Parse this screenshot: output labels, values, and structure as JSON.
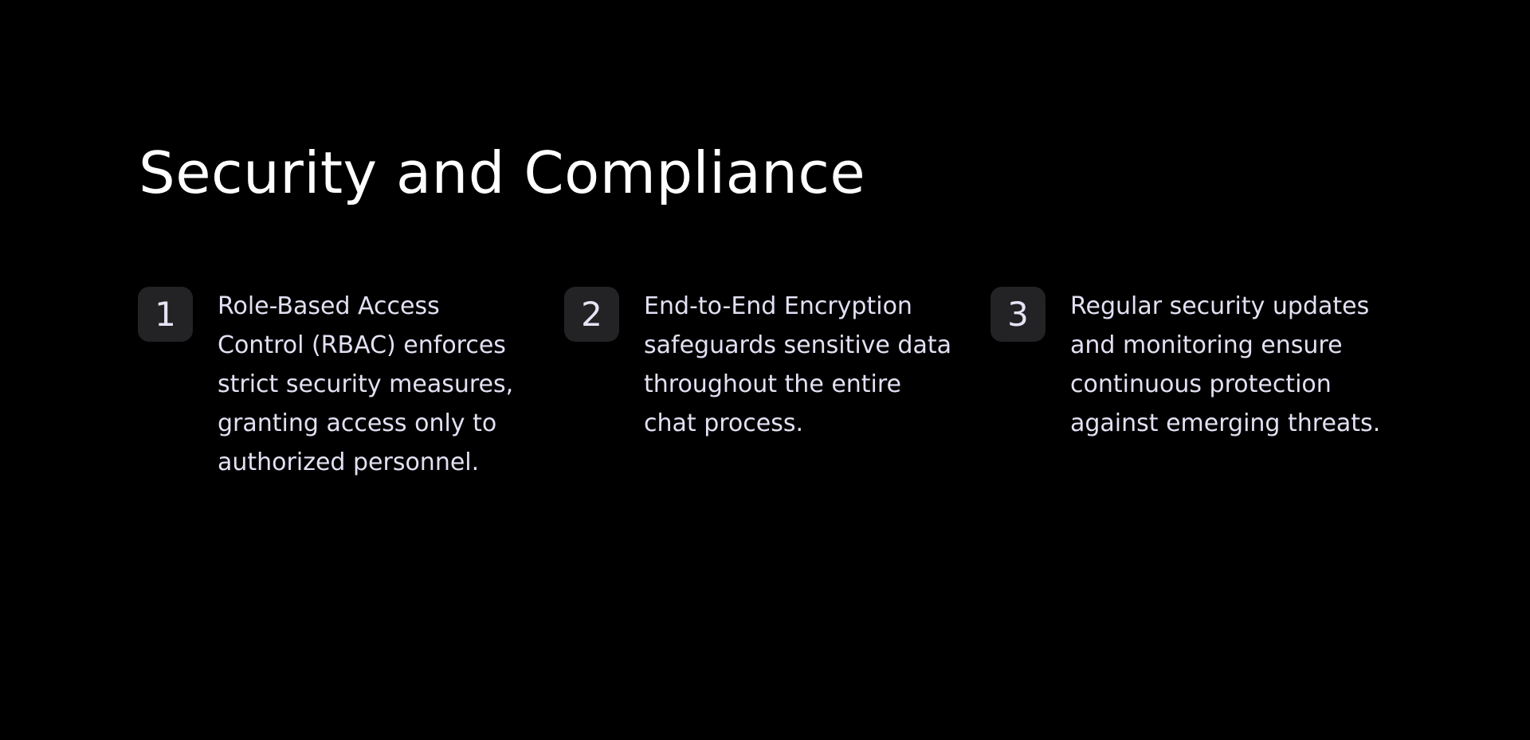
{
  "heading": {
    "title": "Security and Compliance"
  },
  "items": [
    {
      "number": "1",
      "lines": [
        "Role-Based Access",
        "Control (RBAC) enforces",
        "strict security measures,",
        "granting access only to",
        "authorized personnel."
      ]
    },
    {
      "number": "2",
      "lines": [
        "End-to-End Encryption",
        "safeguards sensitive data",
        "throughout the entire",
        "chat process."
      ]
    },
    {
      "number": "3",
      "lines": [
        "Regular security updates",
        "and monitoring ensure",
        "continuous protection",
        "against emerging threats."
      ]
    }
  ],
  "colors": {
    "background": "#000000",
    "title": "#ffffff",
    "badge_background": "#232326",
    "badge_text": "#e6e4f5",
    "body_text": "#e2e0f2"
  }
}
